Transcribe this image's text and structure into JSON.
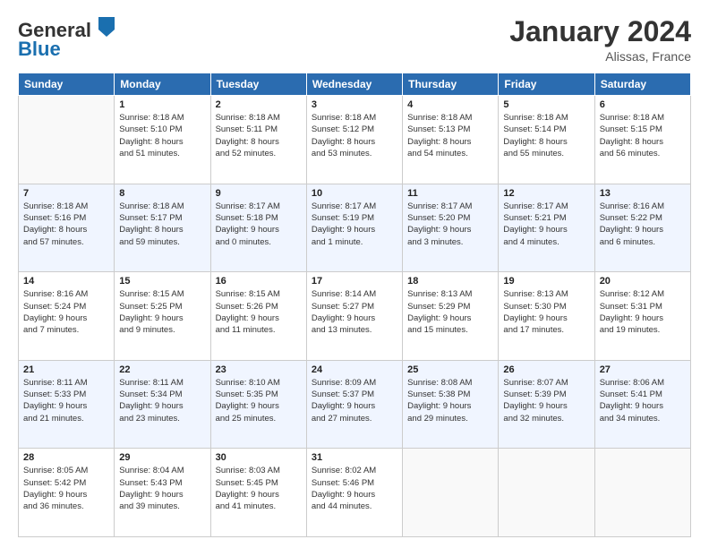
{
  "header": {
    "title": "January 2024",
    "location": "Alissas, France",
    "logo_general": "General",
    "logo_blue": "Blue"
  },
  "weekdays": [
    "Sunday",
    "Monday",
    "Tuesday",
    "Wednesday",
    "Thursday",
    "Friday",
    "Saturday"
  ],
  "weeks": [
    [
      {
        "day": "",
        "sunrise": "",
        "sunset": "",
        "daylight": ""
      },
      {
        "day": "1",
        "sunrise": "Sunrise: 8:18 AM",
        "sunset": "Sunset: 5:10 PM",
        "daylight": "Daylight: 8 hours and 51 minutes."
      },
      {
        "day": "2",
        "sunrise": "Sunrise: 8:18 AM",
        "sunset": "Sunset: 5:11 PM",
        "daylight": "Daylight: 8 hours and 52 minutes."
      },
      {
        "day": "3",
        "sunrise": "Sunrise: 8:18 AM",
        "sunset": "Sunset: 5:12 PM",
        "daylight": "Daylight: 8 hours and 53 minutes."
      },
      {
        "day": "4",
        "sunrise": "Sunrise: 8:18 AM",
        "sunset": "Sunset: 5:13 PM",
        "daylight": "Daylight: 8 hours and 54 minutes."
      },
      {
        "day": "5",
        "sunrise": "Sunrise: 8:18 AM",
        "sunset": "Sunset: 5:14 PM",
        "daylight": "Daylight: 8 hours and 55 minutes."
      },
      {
        "day": "6",
        "sunrise": "Sunrise: 8:18 AM",
        "sunset": "Sunset: 5:15 PM",
        "daylight": "Daylight: 8 hours and 56 minutes."
      }
    ],
    [
      {
        "day": "7",
        "sunrise": "Sunrise: 8:18 AM",
        "sunset": "Sunset: 5:16 PM",
        "daylight": "Daylight: 8 hours and 57 minutes."
      },
      {
        "day": "8",
        "sunrise": "Sunrise: 8:18 AM",
        "sunset": "Sunset: 5:17 PM",
        "daylight": "Daylight: 8 hours and 59 minutes."
      },
      {
        "day": "9",
        "sunrise": "Sunrise: 8:17 AM",
        "sunset": "Sunset: 5:18 PM",
        "daylight": "Daylight: 9 hours and 0 minutes."
      },
      {
        "day": "10",
        "sunrise": "Sunrise: 8:17 AM",
        "sunset": "Sunset: 5:19 PM",
        "daylight": "Daylight: 9 hours and 1 minute."
      },
      {
        "day": "11",
        "sunrise": "Sunrise: 8:17 AM",
        "sunset": "Sunset: 5:20 PM",
        "daylight": "Daylight: 9 hours and 3 minutes."
      },
      {
        "day": "12",
        "sunrise": "Sunrise: 8:17 AM",
        "sunset": "Sunset: 5:21 PM",
        "daylight": "Daylight: 9 hours and 4 minutes."
      },
      {
        "day": "13",
        "sunrise": "Sunrise: 8:16 AM",
        "sunset": "Sunset: 5:22 PM",
        "daylight": "Daylight: 9 hours and 6 minutes."
      }
    ],
    [
      {
        "day": "14",
        "sunrise": "Sunrise: 8:16 AM",
        "sunset": "Sunset: 5:24 PM",
        "daylight": "Daylight: 9 hours and 7 minutes."
      },
      {
        "day": "15",
        "sunrise": "Sunrise: 8:15 AM",
        "sunset": "Sunset: 5:25 PM",
        "daylight": "Daylight: 9 hours and 9 minutes."
      },
      {
        "day": "16",
        "sunrise": "Sunrise: 8:15 AM",
        "sunset": "Sunset: 5:26 PM",
        "daylight": "Daylight: 9 hours and 11 minutes."
      },
      {
        "day": "17",
        "sunrise": "Sunrise: 8:14 AM",
        "sunset": "Sunset: 5:27 PM",
        "daylight": "Daylight: 9 hours and 13 minutes."
      },
      {
        "day": "18",
        "sunrise": "Sunrise: 8:13 AM",
        "sunset": "Sunset: 5:29 PM",
        "daylight": "Daylight: 9 hours and 15 minutes."
      },
      {
        "day": "19",
        "sunrise": "Sunrise: 8:13 AM",
        "sunset": "Sunset: 5:30 PM",
        "daylight": "Daylight: 9 hours and 17 minutes."
      },
      {
        "day": "20",
        "sunrise": "Sunrise: 8:12 AM",
        "sunset": "Sunset: 5:31 PM",
        "daylight": "Daylight: 9 hours and 19 minutes."
      }
    ],
    [
      {
        "day": "21",
        "sunrise": "Sunrise: 8:11 AM",
        "sunset": "Sunset: 5:33 PM",
        "daylight": "Daylight: 9 hours and 21 minutes."
      },
      {
        "day": "22",
        "sunrise": "Sunrise: 8:11 AM",
        "sunset": "Sunset: 5:34 PM",
        "daylight": "Daylight: 9 hours and 23 minutes."
      },
      {
        "day": "23",
        "sunrise": "Sunrise: 8:10 AM",
        "sunset": "Sunset: 5:35 PM",
        "daylight": "Daylight: 9 hours and 25 minutes."
      },
      {
        "day": "24",
        "sunrise": "Sunrise: 8:09 AM",
        "sunset": "Sunset: 5:37 PM",
        "daylight": "Daylight: 9 hours and 27 minutes."
      },
      {
        "day": "25",
        "sunrise": "Sunrise: 8:08 AM",
        "sunset": "Sunset: 5:38 PM",
        "daylight": "Daylight: 9 hours and 29 minutes."
      },
      {
        "day": "26",
        "sunrise": "Sunrise: 8:07 AM",
        "sunset": "Sunset: 5:39 PM",
        "daylight": "Daylight: 9 hours and 32 minutes."
      },
      {
        "day": "27",
        "sunrise": "Sunrise: 8:06 AM",
        "sunset": "Sunset: 5:41 PM",
        "daylight": "Daylight: 9 hours and 34 minutes."
      }
    ],
    [
      {
        "day": "28",
        "sunrise": "Sunrise: 8:05 AM",
        "sunset": "Sunset: 5:42 PM",
        "daylight": "Daylight: 9 hours and 36 minutes."
      },
      {
        "day": "29",
        "sunrise": "Sunrise: 8:04 AM",
        "sunset": "Sunset: 5:43 PM",
        "daylight": "Daylight: 9 hours and 39 minutes."
      },
      {
        "day": "30",
        "sunrise": "Sunrise: 8:03 AM",
        "sunset": "Sunset: 5:45 PM",
        "daylight": "Daylight: 9 hours and 41 minutes."
      },
      {
        "day": "31",
        "sunrise": "Sunrise: 8:02 AM",
        "sunset": "Sunset: 5:46 PM",
        "daylight": "Daylight: 9 hours and 44 minutes."
      },
      {
        "day": "",
        "sunrise": "",
        "sunset": "",
        "daylight": ""
      },
      {
        "day": "",
        "sunrise": "",
        "sunset": "",
        "daylight": ""
      },
      {
        "day": "",
        "sunrise": "",
        "sunset": "",
        "daylight": ""
      }
    ]
  ]
}
